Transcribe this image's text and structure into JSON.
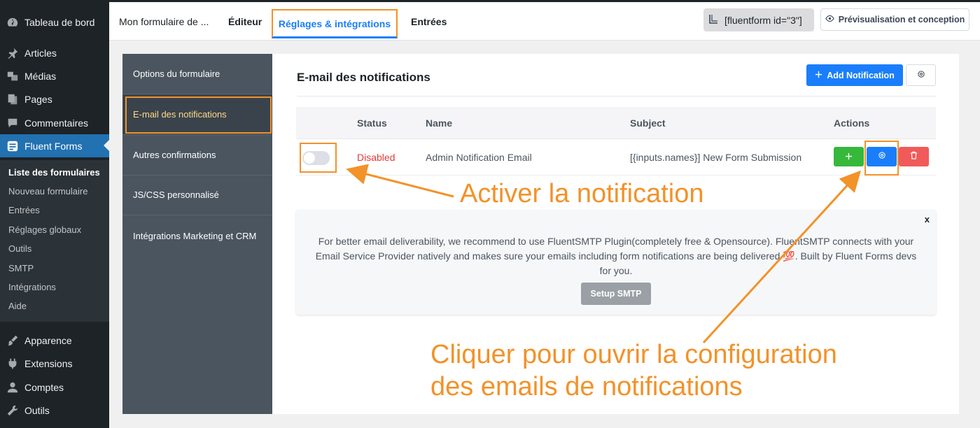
{
  "wp_menu": {
    "items": [
      {
        "label": "Tableau de bord",
        "icon": "dashboard-icon"
      },
      {
        "label": "Articles",
        "icon": "pin-icon"
      },
      {
        "label": "Médias",
        "icon": "media-icon"
      },
      {
        "label": "Pages",
        "icon": "pages-icon"
      },
      {
        "label": "Commentaires",
        "icon": "comments-icon"
      },
      {
        "label": "Fluent Forms",
        "icon": "forms-icon"
      },
      {
        "label": "Apparence",
        "icon": "brush-icon"
      },
      {
        "label": "Extensions",
        "icon": "plugin-icon"
      },
      {
        "label": "Comptes",
        "icon": "user-icon"
      },
      {
        "label": "Outils",
        "icon": "wrench-icon"
      }
    ],
    "submenu": [
      "Liste des formulaires",
      "Nouveau formulaire",
      "Entrées",
      "Réglages globaux",
      "Outils",
      "SMTP",
      "Intégrations",
      "Aide"
    ]
  },
  "header": {
    "form_name": "Mon formulaire de ...",
    "tabs": [
      "Éditeur",
      "Réglages & intégrations",
      "Entrées"
    ],
    "shortcode": "[fluentform id=\"3\"]",
    "preview_label": "Prévisualisation et conception"
  },
  "settings_nav": [
    "Options du formulaire",
    "E-mail des notifications",
    "Autres confirmations",
    "JS/CSS personnalisé",
    "Intégrations Marketing et CRM"
  ],
  "panel": {
    "title": "E-mail des notifications",
    "add_button": "Add Notification",
    "columns": [
      "Status",
      "Name",
      "Subject",
      "Actions"
    ],
    "rows": [
      {
        "status": "Disabled",
        "name": "Admin Notification Email",
        "subject": "[{inputs.names}] New Form Submission"
      }
    ]
  },
  "notice": {
    "close": "x",
    "text": "For better email deliverability, we recommend to use FluentSMTP Plugin(completely free & Opensource). FluentSMTP connects with your Email Service Provider natively and makes sure your emails including form notifications are being delivered 💯. Built by Fluent Forms devs for you.",
    "button": "Setup SMTP"
  },
  "annotations": {
    "toggle": "Activer la notification",
    "config_line1": "Cliquer pour ouvrir la configuration",
    "config_line2": "des emails de notifications"
  },
  "colors": {
    "accent": "#1a7efb",
    "annotation": "#f29229",
    "disabled": "#e03b3b"
  }
}
